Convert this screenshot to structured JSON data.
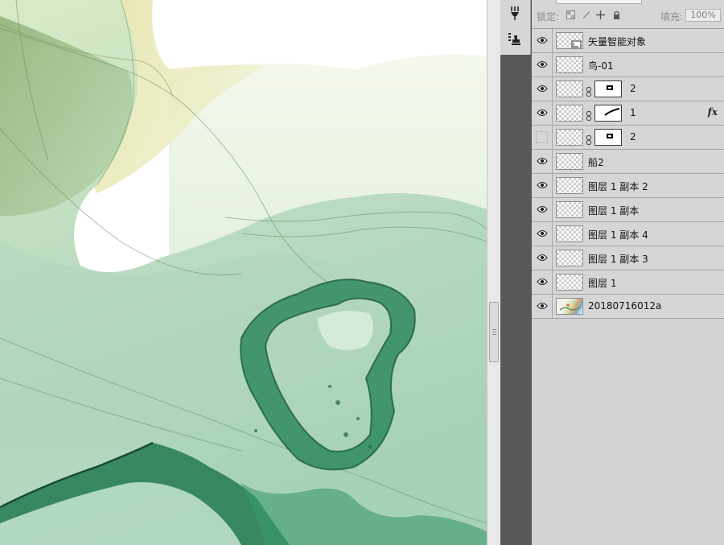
{
  "lock_bar": {
    "lock_label": "锁定:",
    "fill_label": "填充:",
    "fill_value": "100%"
  },
  "layers": [
    {
      "name": "矢量智能对象",
      "visible": true,
      "thumb": "smart-object",
      "mask": false,
      "fx": ""
    },
    {
      "name": "鸟-01",
      "visible": true,
      "thumb": "transparent",
      "mask": false,
      "fx": ""
    },
    {
      "name": "2",
      "visible": true,
      "thumb": "transparent",
      "mask": true,
      "fx": ""
    },
    {
      "name": "1",
      "visible": true,
      "thumb": "transparent",
      "mask": true,
      "fx": "fx"
    },
    {
      "name": "2",
      "visible": false,
      "thumb": "transparent",
      "mask": true,
      "fx": ""
    },
    {
      "name": "船2",
      "visible": true,
      "thumb": "transparent",
      "mask": false,
      "fx": ""
    },
    {
      "name": "图层 1 副本 2",
      "visible": true,
      "thumb": "transparent",
      "mask": false,
      "fx": ""
    },
    {
      "name": "图层 1 副本",
      "visible": true,
      "thumb": "transparent",
      "mask": false,
      "fx": ""
    },
    {
      "name": "图层 1 副本 4",
      "visible": true,
      "thumb": "transparent",
      "mask": false,
      "fx": ""
    },
    {
      "name": "图层 1 副本 3",
      "visible": true,
      "thumb": "transparent",
      "mask": false,
      "fx": ""
    },
    {
      "name": "图层 1",
      "visible": true,
      "thumb": "transparent",
      "mask": false,
      "fx": ""
    },
    {
      "name": "20180716012a",
      "visible": true,
      "thumb": "image",
      "mask": false,
      "fx": ""
    }
  ],
  "colors": {
    "canvas_light_green": "#cfe6cf",
    "canvas_dark_green": "#2e8a5e",
    "canvas_yellow": "#e6e3a6",
    "panel_bg": "#d4d4d4"
  }
}
